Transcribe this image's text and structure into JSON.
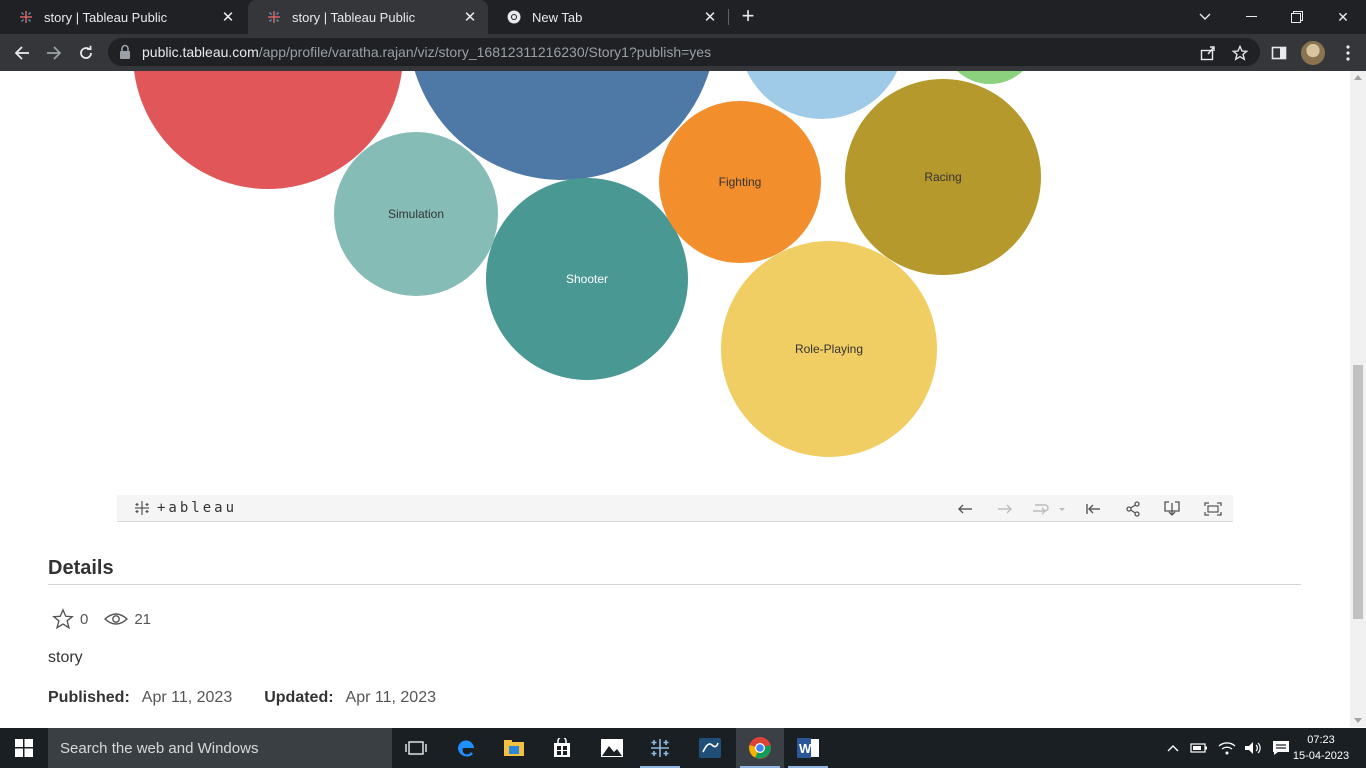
{
  "browser": {
    "tabs": [
      {
        "title": "story | Tableau Public"
      },
      {
        "title": "story | Tableau Public"
      },
      {
        "title": "New Tab"
      }
    ],
    "url_host": "public.tableau.com",
    "url_path": "/app/profile/varatha.rajan/viz/story_16812311216230/Story1?publish=yes"
  },
  "viz": {
    "bubbles": [
      {
        "label": "",
        "color": "#e15759"
      },
      {
        "label": "",
        "color": "#4e79a7"
      },
      {
        "label": "",
        "color": "#a0cbe8"
      },
      {
        "label": "",
        "color": "#8cd17d"
      },
      {
        "label": "Simulation",
        "color": "#86bcb6"
      },
      {
        "label": "Shooter",
        "color": "#499894"
      },
      {
        "label": "Fighting",
        "color": "#f28e2b"
      },
      {
        "label": "Racing",
        "color": "#b6992d"
      },
      {
        "label": "Role-Playing",
        "color": "#f1ce63"
      }
    ],
    "logo_text": "+ableau"
  },
  "details": {
    "title": "Details",
    "favorites": "0",
    "views": "21",
    "viz_name": "story",
    "published_label": "Published:",
    "published_date": "Apr 11, 2023",
    "updated_label": "Updated:",
    "updated_date": "Apr 11, 2023"
  },
  "taskbar": {
    "search_placeholder": "Search the web and Windows",
    "time": "07:23",
    "date": "15-04-2023"
  }
}
